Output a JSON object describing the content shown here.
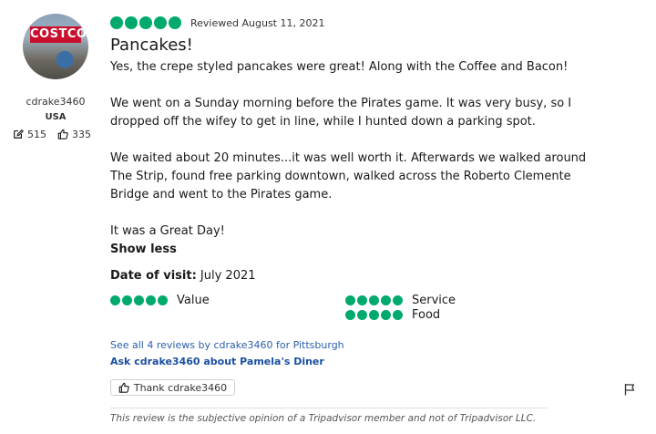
{
  "user": {
    "avatar_sign_text": "COSTCO",
    "username": "cdrake3460",
    "country": "USA",
    "contributions": "515",
    "helpful_votes": "335"
  },
  "review": {
    "rating": 5,
    "reviewed_date": "Reviewed August 11, 2021",
    "title": "Pancakes!",
    "paragraphs": [
      "Yes, the crepe styled pancakes were great! Along with the Coffee and Bacon!",
      "We went on a Sunday morning before the Pirates game. It was very busy, so I dropped off the wifey to get in line, while I hunted down a parking spot.",
      "We waited about 20 minutes...it was well worth it. Afterwards we walked around The Strip, found free parking downtown, walked across the Roberto Clemente Bridge and went to the Pirates game.",
      "It was a Great Day!"
    ],
    "show_less": "Show less",
    "date_of_visit_label": "Date of visit:",
    "date_of_visit_value": " July 2021",
    "subratings": [
      {
        "label": "Value",
        "rating": 5
      },
      {
        "label": "Service",
        "rating": 5
      },
      {
        "label": "Food",
        "rating": 5
      }
    ]
  },
  "links": {
    "see_all": "See all 4 reviews by cdrake3460 for Pittsburgh",
    "ask": "Ask cdrake3460 about Pamela's Diner"
  },
  "thank_button": "Thank cdrake3460",
  "disclaimer": "This review is the subjective opinion of a Tripadvisor member and not of Tripadvisor LLC.",
  "colors": {
    "bubble": "#00aa6c"
  }
}
